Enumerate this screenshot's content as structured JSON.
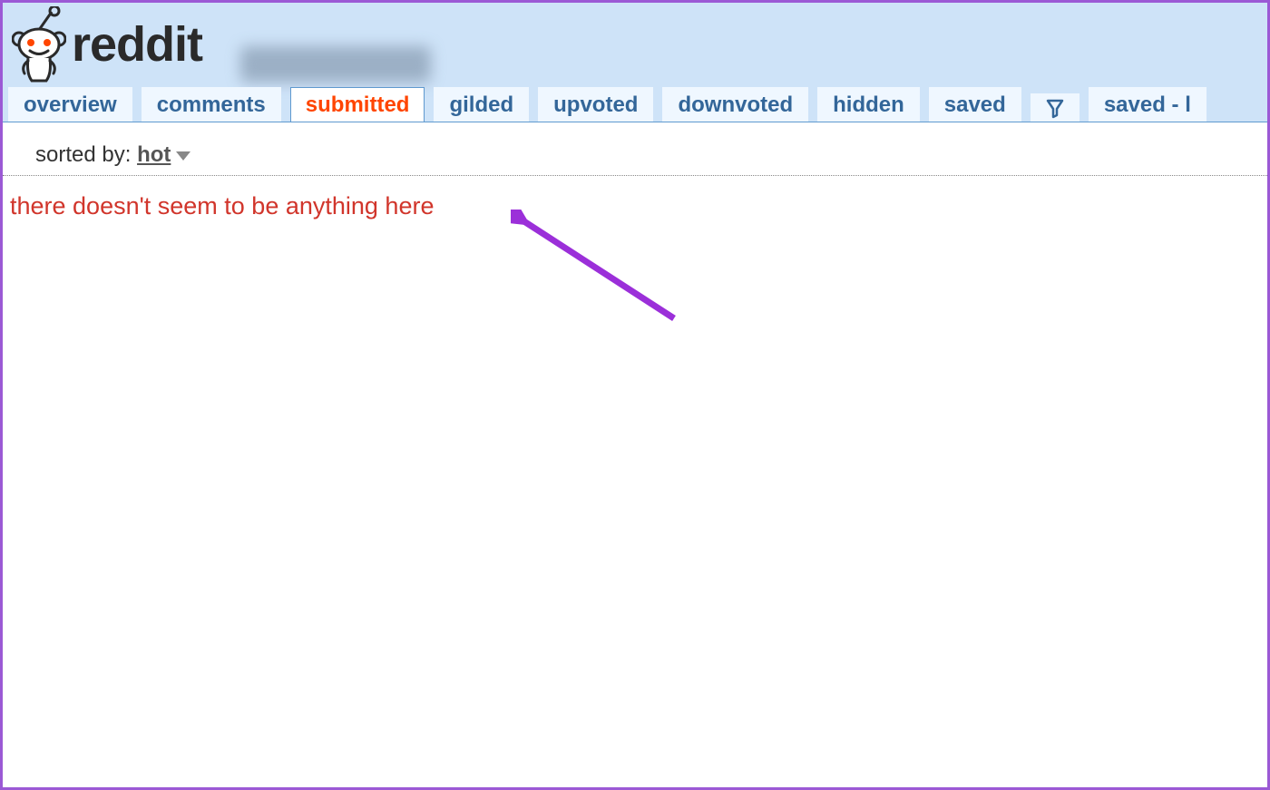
{
  "header": {
    "wordmark": "reddit"
  },
  "tabs": [
    {
      "label": "overview"
    },
    {
      "label": "comments"
    },
    {
      "label": "submitted"
    },
    {
      "label": "gilded"
    },
    {
      "label": "upvoted"
    },
    {
      "label": "downvoted"
    },
    {
      "label": "hidden"
    },
    {
      "label": "saved"
    },
    {
      "icon": "filter-icon"
    },
    {
      "label": "saved - l"
    }
  ],
  "active_tab": "submitted",
  "sort": {
    "prefix": "sorted by: ",
    "value": "hot"
  },
  "empty_message": "there doesn't seem to be anything here"
}
